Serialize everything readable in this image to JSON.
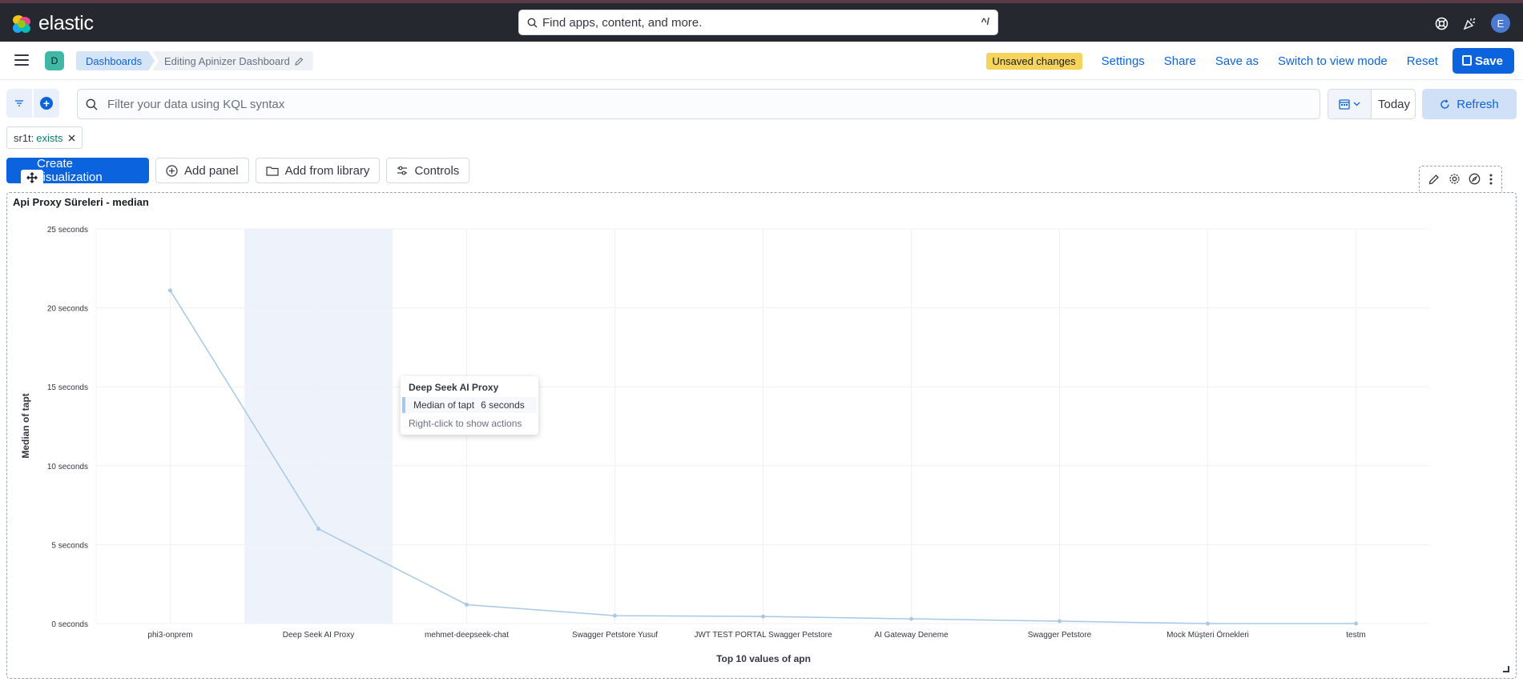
{
  "header": {
    "brand": "elastic",
    "search_placeholder": "Find apps, content, and more.",
    "search_shortcut": "^/",
    "avatar_initial": "E"
  },
  "nav": {
    "space_initial": "D",
    "breadcrumbs": [
      "Dashboards",
      "Editing Apinizer Dashboard"
    ],
    "unsaved_badge": "Unsaved changes",
    "actions": [
      "Settings",
      "Share",
      "Save as",
      "Switch to view mode",
      "Reset"
    ],
    "save_label": "Save"
  },
  "query": {
    "kql_placeholder": "Filter your data using KQL syntax",
    "date_label": "Today",
    "refresh_label": "Refresh"
  },
  "filter_pill": {
    "field": "sr1t:",
    "value": "exists"
  },
  "toolbar": {
    "create_label": "Create visualization",
    "add_panel_label": "Add panel",
    "add_library_label": "Add from library",
    "controls_label": "Controls"
  },
  "panel": {
    "title": "Api Proxy Süreleri - median"
  },
  "tooltip": {
    "title": "Deep Seek AI Proxy",
    "metric": "Median of tapt",
    "value": "6 seconds",
    "hint": "Right-click to show actions"
  },
  "colors": {
    "accent": "#0b64dd",
    "series_line": "#a8c8e8",
    "highlight_band": "#eef3fb",
    "unsaved": "#f6d35b"
  },
  "chart_data": {
    "type": "line",
    "xlabel": "Top 10 values of apn",
    "ylabel": "Median of tapt",
    "ylim": [
      0,
      25
    ],
    "y_ticks": [
      "0 seconds",
      "5 seconds",
      "10 seconds",
      "15 seconds",
      "20 seconds",
      "25 seconds"
    ],
    "y_tick_values": [
      0,
      5,
      10,
      15,
      20,
      25
    ],
    "categories": [
      "phi3-onprem",
      "Deep Seek AI Proxy",
      "mehmet-deepseek-chat",
      "Swagger Petstore Yusuf",
      "JWT TEST PORTAL Swagger Petstore",
      "AI Gateway Deneme",
      "Swagger Petstore",
      "Mock Müşteri Örnekleri",
      "testm"
    ],
    "series": [
      {
        "values": [
          21.1,
          6.0,
          1.2,
          0.5,
          0.45,
          0.3,
          0.15,
          0.0,
          0.0
        ]
      }
    ],
    "highlighted_category": "Deep Seek AI Proxy",
    "grid": true
  }
}
